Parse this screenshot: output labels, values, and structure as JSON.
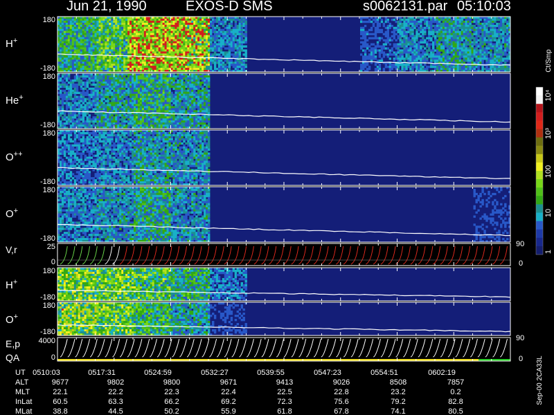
{
  "header": {
    "date": "Jun 21, 1990",
    "instrument": "EXOS-D SMS",
    "file": "s0062131.par",
    "time": "05:10:03"
  },
  "colorbar": {
    "unit": "Ct/Smp",
    "labels": [
      "10⁴",
      "10³",
      "100",
      "10",
      "1"
    ],
    "colors": [
      "#ffffff",
      "#f4f4f4",
      "#b4141a",
      "#d21e1e",
      "#e02818",
      "#b03010",
      "#6e6e10",
      "#8a8a12",
      "#c8c818",
      "#f0f020",
      "#b0e020",
      "#78d818",
      "#50c018",
      "#32a814",
      "#1c9090",
      "#18b0c8",
      "#2858c8",
      "#1e3aa8",
      "#18288c",
      "#141e6e"
    ]
  },
  "chart_data": [
    {
      "panel": "H+",
      "type": "heatmap",
      "ylabel": "H+",
      "yticks": [
        "180",
        "-180"
      ],
      "activity": [
        0.55,
        0.7,
        1.0,
        0.95,
        0.35,
        0.1,
        0.15,
        0.1,
        0.25,
        0.35,
        0.45,
        0.4
      ],
      "peak_bands": [
        [
          0.153,
          0.285
        ]
      ]
    },
    {
      "panel": "He+",
      "type": "heatmap",
      "ylabel": "He+",
      "yticks": [
        "180",
        "-180"
      ],
      "activity": [
        0.35,
        0.45,
        0.55,
        0.45,
        0.15,
        0.05,
        0.05,
        0.05,
        0.05,
        0.1,
        0.1,
        0.05
      ]
    },
    {
      "panel": "O++",
      "type": "heatmap",
      "ylabel": "O++",
      "yticks": [
        "180",
        "-180"
      ],
      "activity": [
        0.3,
        0.35,
        0.45,
        0.4,
        0.1,
        0.03,
        0.03,
        0.03,
        0.03,
        0.05,
        0.05,
        0.03
      ]
    },
    {
      "panel": "O+",
      "type": "heatmap",
      "ylabel": "O+",
      "yticks": [
        "180",
        "-180"
      ],
      "activity": [
        0.35,
        0.4,
        0.5,
        0.4,
        0.12,
        0.05,
        0.05,
        0.05,
        0.05,
        0.1,
        0.15,
        0.2
      ]
    },
    {
      "panel": "V,r",
      "type": "line",
      "ylabel": "V,r",
      "yticks": [
        "25",
        "0"
      ],
      "right_ticks": [
        "90",
        "0"
      ]
    },
    {
      "panel": "H+ (2)",
      "type": "heatmap",
      "ylabel": "H+",
      "yticks": [
        "180",
        "-180"
      ],
      "activity": [
        0.8,
        0.75,
        0.7,
        0.55,
        0.3,
        0.05,
        0.05,
        0.05,
        0.1,
        0.1,
        0.05,
        0.03
      ]
    },
    {
      "panel": "O+ (2)",
      "type": "heatmap",
      "ylabel": "O+",
      "yticks": [
        "180",
        "-180"
      ],
      "activity": [
        0.85,
        0.75,
        0.6,
        0.45,
        0.2,
        0.05,
        0.05,
        0.05,
        0.05,
        0.05,
        0.03,
        0.03
      ]
    },
    {
      "panel": "E,p QA",
      "type": "line",
      "ylabel": "E,p",
      "ylabel2": "QA",
      "yticks": [
        "4000",
        "0"
      ],
      "right_ticks": [
        "90",
        "0"
      ]
    }
  ],
  "footer": {
    "rows": [
      {
        "label": "UT",
        "values": [
          "0510:03",
          "0517:31",
          "0524:59",
          "0532:27",
          "0539:55",
          "0547:23",
          "0554:51",
          "0602:19"
        ]
      },
      {
        "label": "ALT",
        "values": [
          "9677",
          "9802",
          "9800",
          "9671",
          "9413",
          "9026",
          "8508",
          "7857"
        ]
      },
      {
        "label": "MLT",
        "values": [
          "22.1",
          "22.2",
          "22.3",
          "22.4",
          "22.5",
          "22.8",
          "23.2",
          "0.2"
        ]
      },
      {
        "label": "InLat",
        "values": [
          "60.5",
          "63.3",
          "66.2",
          "69.2",
          "72.3",
          "75.6",
          "79.2",
          "82.8"
        ]
      },
      {
        "label": "MLat",
        "values": [
          "38.8",
          "44.5",
          "50.2",
          "55.9",
          "61.8",
          "67.8",
          "74.1",
          "80.5"
        ]
      }
    ],
    "sidenote": "Sep-00 2CA33L"
  }
}
